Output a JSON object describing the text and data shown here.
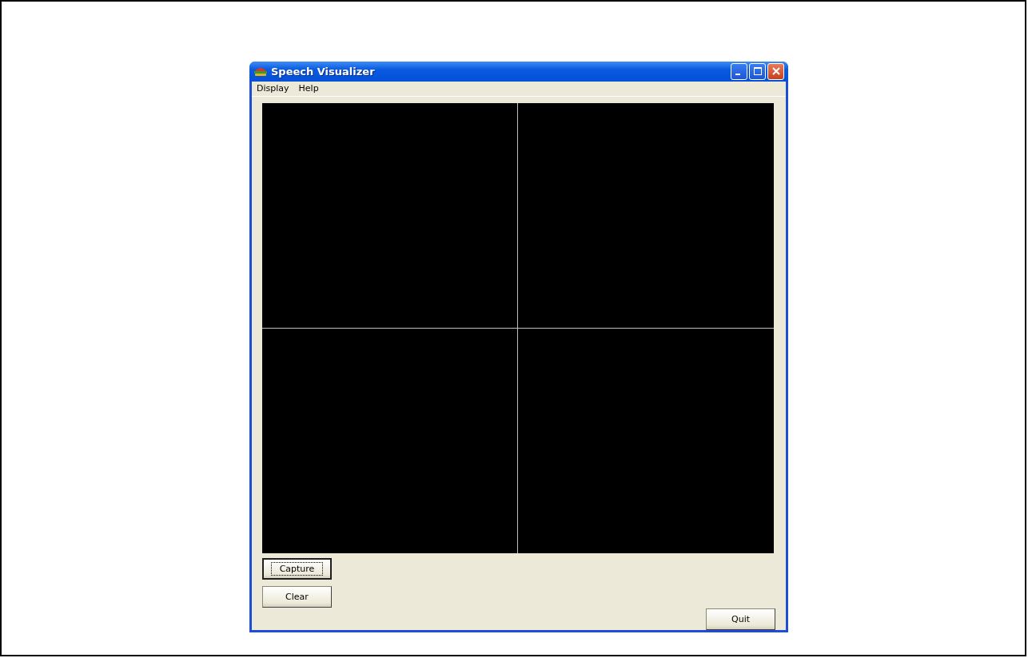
{
  "window": {
    "title": "Speech Visualizer"
  },
  "menu": [
    {
      "label": "Display"
    },
    {
      "label": "Help"
    }
  ],
  "buttons": [
    {
      "label": "Capture",
      "focused": true
    },
    {
      "label": "Clear",
      "focused": false
    }
  ],
  "quit_button": {
    "label": "Quit",
    "focused": false
  }
}
